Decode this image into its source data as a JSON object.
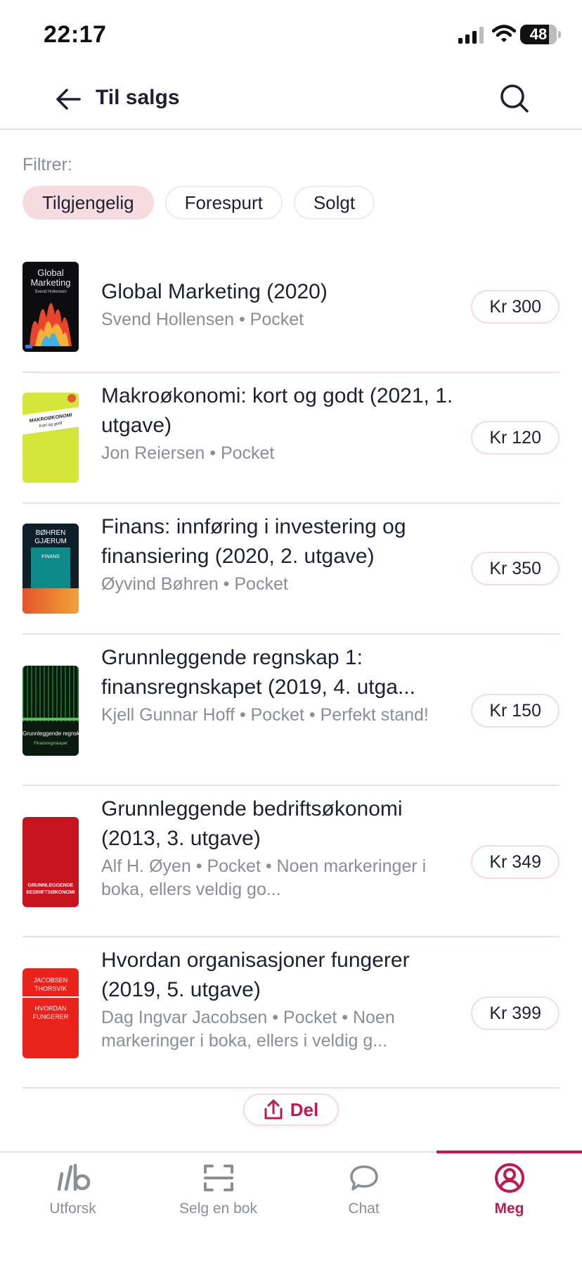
{
  "status_bar": {
    "time": "22:17",
    "battery": "48"
  },
  "header": {
    "title": "Til salgs"
  },
  "filter": {
    "label": "Filtrer:",
    "chips": [
      "Tilgjengelig",
      "Forespurt",
      "Solgt"
    ],
    "active": "Tilgjengelig"
  },
  "books": [
    {
      "title": "Global Marketing (2020)",
      "meta": "Svend Hollensen • Pocket",
      "price": "Kr 300",
      "cover": {
        "line1": "Global",
        "line2": "Marketing",
        "line3": "Svend Hollensen"
      }
    },
    {
      "title": "Makroøkonomi: kort og godt (2021, 1. utgave)",
      "meta": "Jon Reiersen • Pocket",
      "price": "Kr 120",
      "cover": {
        "line1": "MAKROØKONOMI",
        "line2": "Kort og godt"
      }
    },
    {
      "title": "Finans: innføring i investering og finansiering (2020, 2. utgave)",
      "meta": "Øyvind Bøhren • Pocket",
      "price": "Kr 350",
      "cover": {
        "line1": "BØHREN",
        "line2": "GJÆRUM",
        "line3": "FINANS"
      }
    },
    {
      "title": "Grunnleggende regnskap 1: finansregnskapet (2019, 4. utga...",
      "meta": "Kjell Gunnar Hoff • Pocket • Perfekt stand!",
      "price": "Kr 150",
      "cover": {
        "line1": "Grunnleggende regnskap",
        "line2": "Finansregnskapet"
      }
    },
    {
      "title": "Grunnleggende bedriftsøkonomi (2013, 3. utgave)",
      "meta": "Alf H. Øyen • Pocket • Noen markeringer i boka, ellers veldig go...",
      "price": "Kr 349",
      "cover": {
        "line1": "GRUNNLEGGENDE",
        "line2": "BEDRIFTSØKONOMI"
      }
    },
    {
      "title": "Hvordan organisasjoner fungerer (2019, 5. utgave)",
      "meta": "Dag Ingvar Jacobsen • Pocket • Noen markeringer i boka, ellers i veldig g...",
      "price": "Kr 399",
      "cover": {
        "line1": "JACOBSEN",
        "line2": "THORSVIK",
        "line3": "HVORDAN",
        "line4": "FUNGERER"
      }
    }
  ],
  "share": {
    "label": "Del"
  },
  "tabs": [
    {
      "label": "Utforsk",
      "icon": "logo-icon"
    },
    {
      "label": "Selg en bok",
      "icon": "scan-icon"
    },
    {
      "label": "Chat",
      "icon": "chat-bubble-icon"
    },
    {
      "label": "Meg",
      "icon": "user-circle-icon"
    }
  ],
  "active_tab": "Meg",
  "colors": {
    "accent": "#c2194c",
    "chip_active_bg": "#f6dbe1",
    "divider": "#f3dde3",
    "muted_text": "#8b8e97"
  }
}
